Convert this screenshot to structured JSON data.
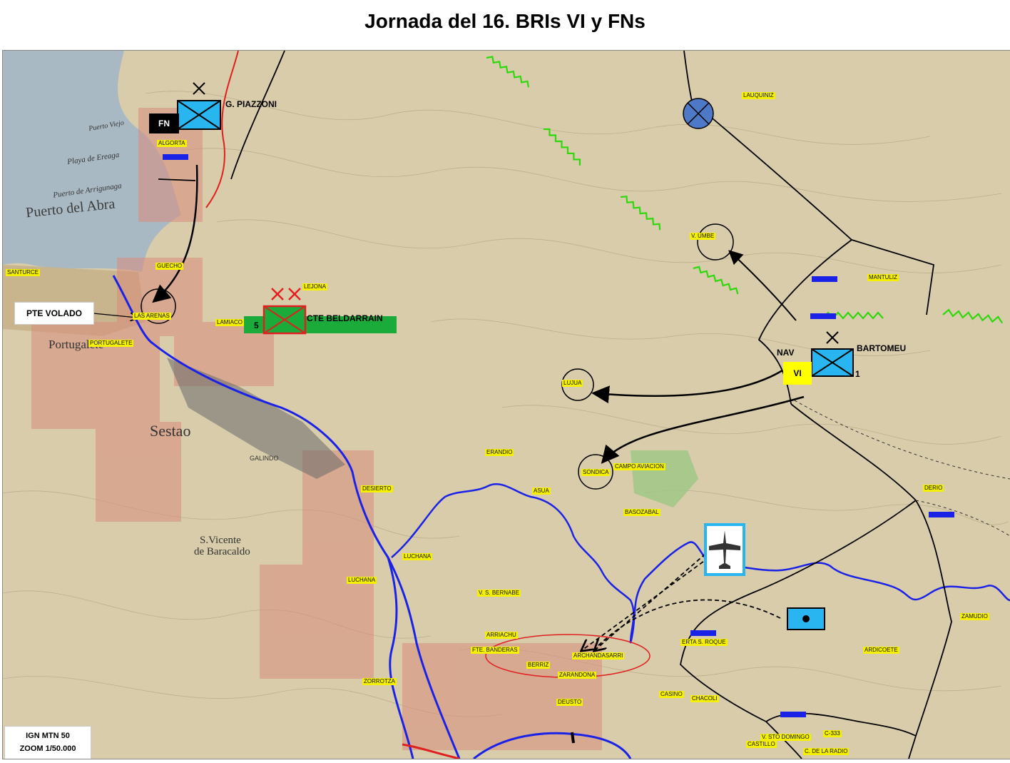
{
  "title": "Jornada del 16. BRIs VI y FNs",
  "units": {
    "piazzoni": {
      "name": "G. PIAZZONI",
      "tag": "FN"
    },
    "beldarrain": {
      "name": "CTE BELDARRAIN",
      "number": "5"
    },
    "bartomeu": {
      "name": "BARTOMEU",
      "tag": "VI",
      "nav": "NAV",
      "number": "1"
    }
  },
  "callouts": {
    "pte_volado": "PTE VOLADO"
  },
  "source": {
    "line1": "IGN MTN 50",
    "line2": "ZOOM 1/50.000"
  },
  "place_labels": {
    "algorta": "ALGORTA",
    "guecho": "GUECHO",
    "santurce": "SANTURCE",
    "las_arenas": "LAS ARENAS",
    "portugalete": "PORTUGALETE",
    "lejona": "LEJONA",
    "lamiaco": "LAMIACO",
    "lauquiniz": "LAUQUINIZ",
    "v_umbe": "V. UMBE",
    "mantuliz": "MANTULIZ",
    "lujua": "LUJUA",
    "sondica": "SONDICA",
    "campo_aviacion": "CAMPO AVIACION",
    "erandio": "ERANDIO",
    "desierto": "DESIERTO",
    "asua": "ASUA",
    "basozabal": "BASOZABAL",
    "derio": "DERIO",
    "luchana_1": "LUCHANA",
    "luchana_2": "LUCHANA",
    "v_s_bernabe": "V. S. BERNABE",
    "arriachu": "ARRIACHU",
    "fte_banderas": "FTE. BANDERAS",
    "archandasarri": "ARCHANDASARRI",
    "berriz": "BERRIZ",
    "zarandona": "ZARANDONA",
    "zorrotza": "ZORROTZA",
    "casino": "CASINO",
    "chacoli": "CHACOLI",
    "deusto": "DEUSTO",
    "erta_s_roque": "ERTA S. ROQUE",
    "ardicoete": "ARDICOETE",
    "zamudio": "ZAMUDIO",
    "v_sto_domingo": "V. STO DOMINGO",
    "castillo": "CASTILLO",
    "c_333": "C-333",
    "c_de_la_radio": "C. DE LA RADIO"
  },
  "base_map_text": {
    "puerto_del_abra": "Puerto del Abra",
    "sestao": "Sestao",
    "s_vicente": "S.Vicente",
    "de_baracaldo": "de Baracaldo",
    "portugalete": "Portugalete",
    "galindo": "GALINDO",
    "playa_de_ereaga": "Playa de Ereaga",
    "puerto_de_arrigunaga": "Puerto de Arrigunaga",
    "puerto_viejo": "Puerto Viejo"
  },
  "colors": {
    "red_force": "#e02020",
    "blue_force": "#29b6f0",
    "green_force": "#1aab3a",
    "trench_green": "#2fd80c",
    "river_blue": "#1b22e8",
    "label_yellow": "#f4f000"
  },
  "icons": [
    "x-mark-icon",
    "airplane-icon",
    "artillery-icon",
    "headquarters-circle-icon"
  ]
}
